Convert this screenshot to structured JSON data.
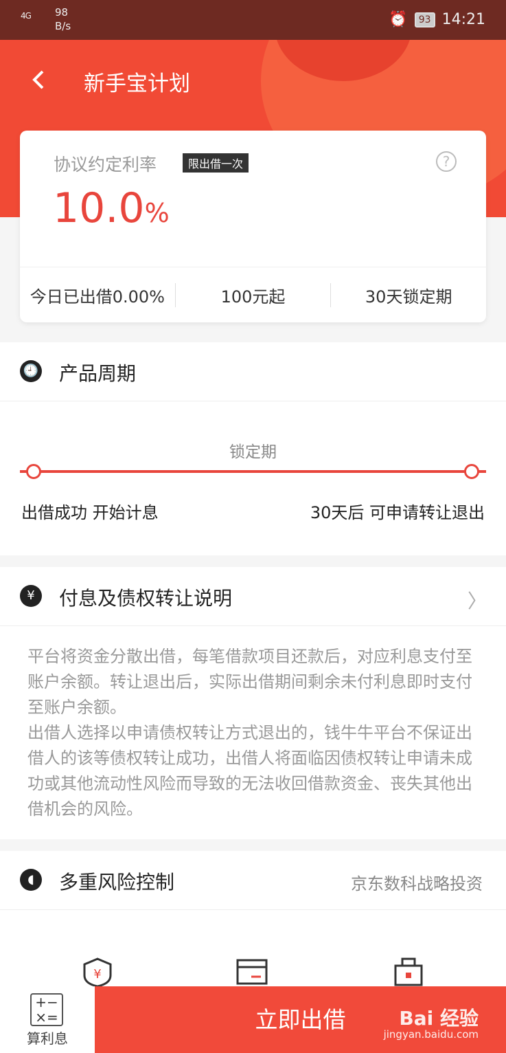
{
  "status": {
    "signal": "4G",
    "net": "98",
    "net_unit": "B/s",
    "battery": "93",
    "time": "14:21"
  },
  "header": {
    "title": "新手宝计划"
  },
  "rate_card": {
    "label": "协议约定利率",
    "badge": "限出借一次",
    "help": "?",
    "rate": "10.0",
    "rate_unit": "%",
    "stats": [
      "今日已出借0.00%",
      "100元起",
      "30天锁定期"
    ]
  },
  "cycle": {
    "title": "产品周期",
    "lock_label": "锁定期",
    "start": "出借成功 开始计息",
    "end": "30天后 可申请转让退出"
  },
  "interest": {
    "title": "付息及债权转让说明",
    "chevron": "〉",
    "para1": "平台将资金分散出借，每笔借款项目还款后，对应利息支付至账户余额。转让退出后，实际出借期间剩余未付利息即时支付至账户余额。",
    "para2": "出借人选择以申请债权转让方式退出的，钱牛牛平台不保证出借人的该等债权转让成功，出借人将面临因债权转让申请未成功或其他流动性风险而导致的无法收回借款资金、丧失其他出借机会的风险。"
  },
  "risk": {
    "title": "多重风险控制",
    "extra": "京东数科战略投资"
  },
  "bottom": {
    "calc_label": "算利息",
    "cta": "立即出借"
  },
  "watermark": {
    "logo": "Bai 经验",
    "url": "jingyan.baidu.com"
  },
  "colors": {
    "brand": "#f14a35",
    "accent": "#e8453c"
  }
}
